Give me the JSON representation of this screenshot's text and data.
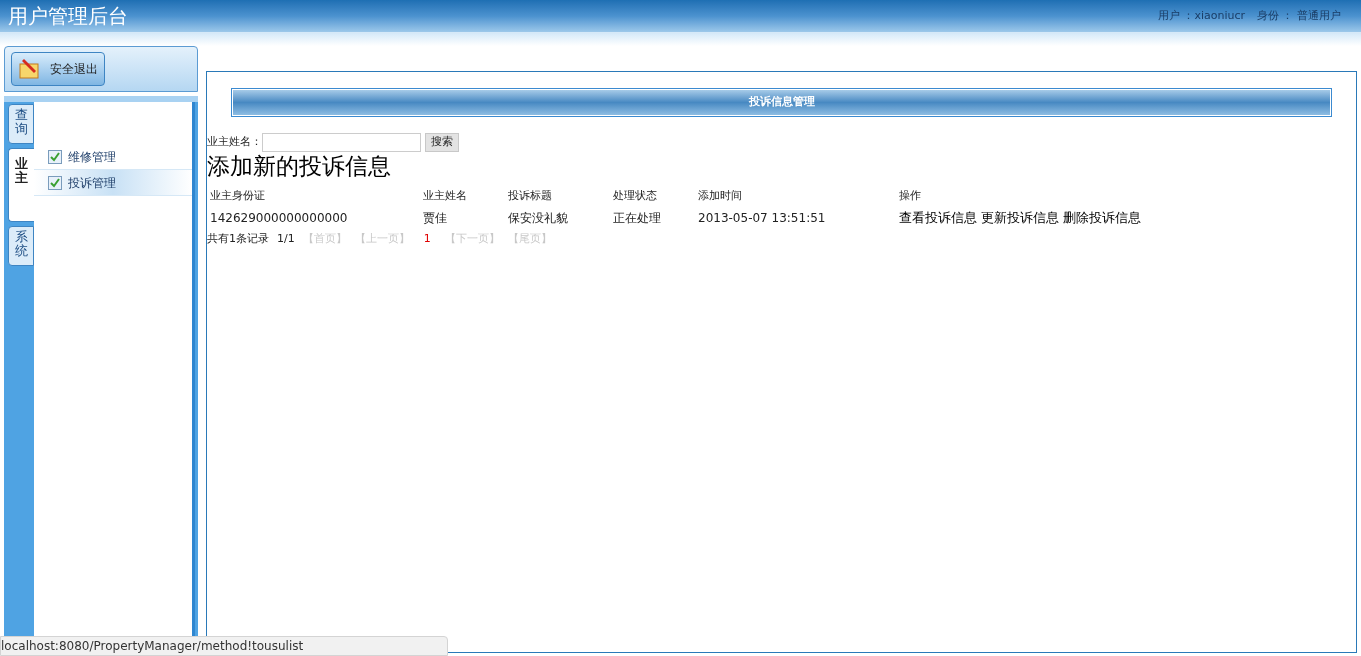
{
  "header": {
    "title": "用户管理后台",
    "user_label": "用户 ：xiaoniucr",
    "role_label": "身份 ： 普通用户"
  },
  "sidebar": {
    "logout": "安全退出",
    "tabs": [
      {
        "label": "查询",
        "selected": false
      },
      {
        "label": "业主",
        "selected": true
      },
      {
        "label": "系统",
        "selected": false
      }
    ],
    "items": [
      {
        "label": "维修管理",
        "selected": false
      },
      {
        "label": "投诉管理",
        "selected": true
      }
    ]
  },
  "main": {
    "panel_title": "投诉信息管理",
    "search_label": "业主姓名：",
    "search_button": "搜索",
    "add_link": "添加新的投诉信息",
    "table": {
      "columns": [
        "业主身份证",
        "业主姓名",
        "投诉标题",
        "处理状态",
        "添加时间",
        "操作"
      ],
      "rows": [
        {
          "cells": [
            "142629000000000000",
            "贾佳",
            "保安没礼貌",
            "正在处理",
            "2013-05-07 13:51:51"
          ],
          "actions": [
            "查看投诉信息",
            "更新投诉信息",
            "删除投诉信息"
          ]
        }
      ]
    },
    "pagination": {
      "summary": "共有1条记录",
      "page_count": "1/1",
      "links": [
        {
          "label": "【首页】",
          "disabled": true
        },
        {
          "label": "【上一页】",
          "disabled": true
        },
        {
          "label": "1",
          "kind": "current"
        },
        {
          "label": "【下一页】",
          "disabled": true
        },
        {
          "label": "【尾页】",
          "disabled": true
        }
      ]
    }
  },
  "status_bar": {
    "url": "localhost:8080/PropertyManager/method!tousulist"
  }
}
